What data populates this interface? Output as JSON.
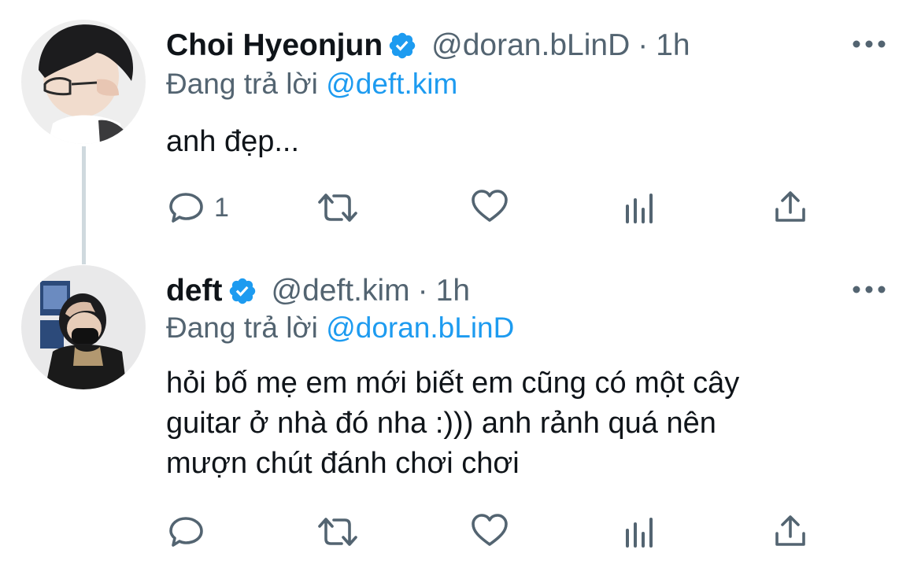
{
  "tweets": [
    {
      "name": "Choi Hyeonjun",
      "handle": "@doran.bLinD",
      "separator": "·",
      "time": "1h",
      "reply_prefix": "Đang trả lời",
      "reply_to": "@deft.kim",
      "text": "anh đẹp...",
      "reply_count": "1",
      "icons": [
        "reply-icon",
        "retweet-icon",
        "like-icon",
        "views-icon",
        "share-icon"
      ]
    },
    {
      "name": "deft",
      "handle": "@deft.kim",
      "separator": "·",
      "time": "1h",
      "reply_prefix": "Đang trả lời",
      "reply_to": "@doran.bLinD",
      "text_lines": [
        "hỏi bố mẹ em mới biết em cũng có một cây",
        "guitar ở nhà đó nha :))) anh rảnh quá nên",
        "mượn chút đánh chơi chơi"
      ],
      "reply_count": "",
      "icons": [
        "reply-icon",
        "retweet-icon",
        "like-icon",
        "views-icon",
        "share-icon"
      ]
    }
  ],
  "colors": {
    "verified": "#1d9bf0",
    "mention": "#1d9bf0",
    "secondary_text": "#536471",
    "thread_line": "#cfd9de"
  }
}
